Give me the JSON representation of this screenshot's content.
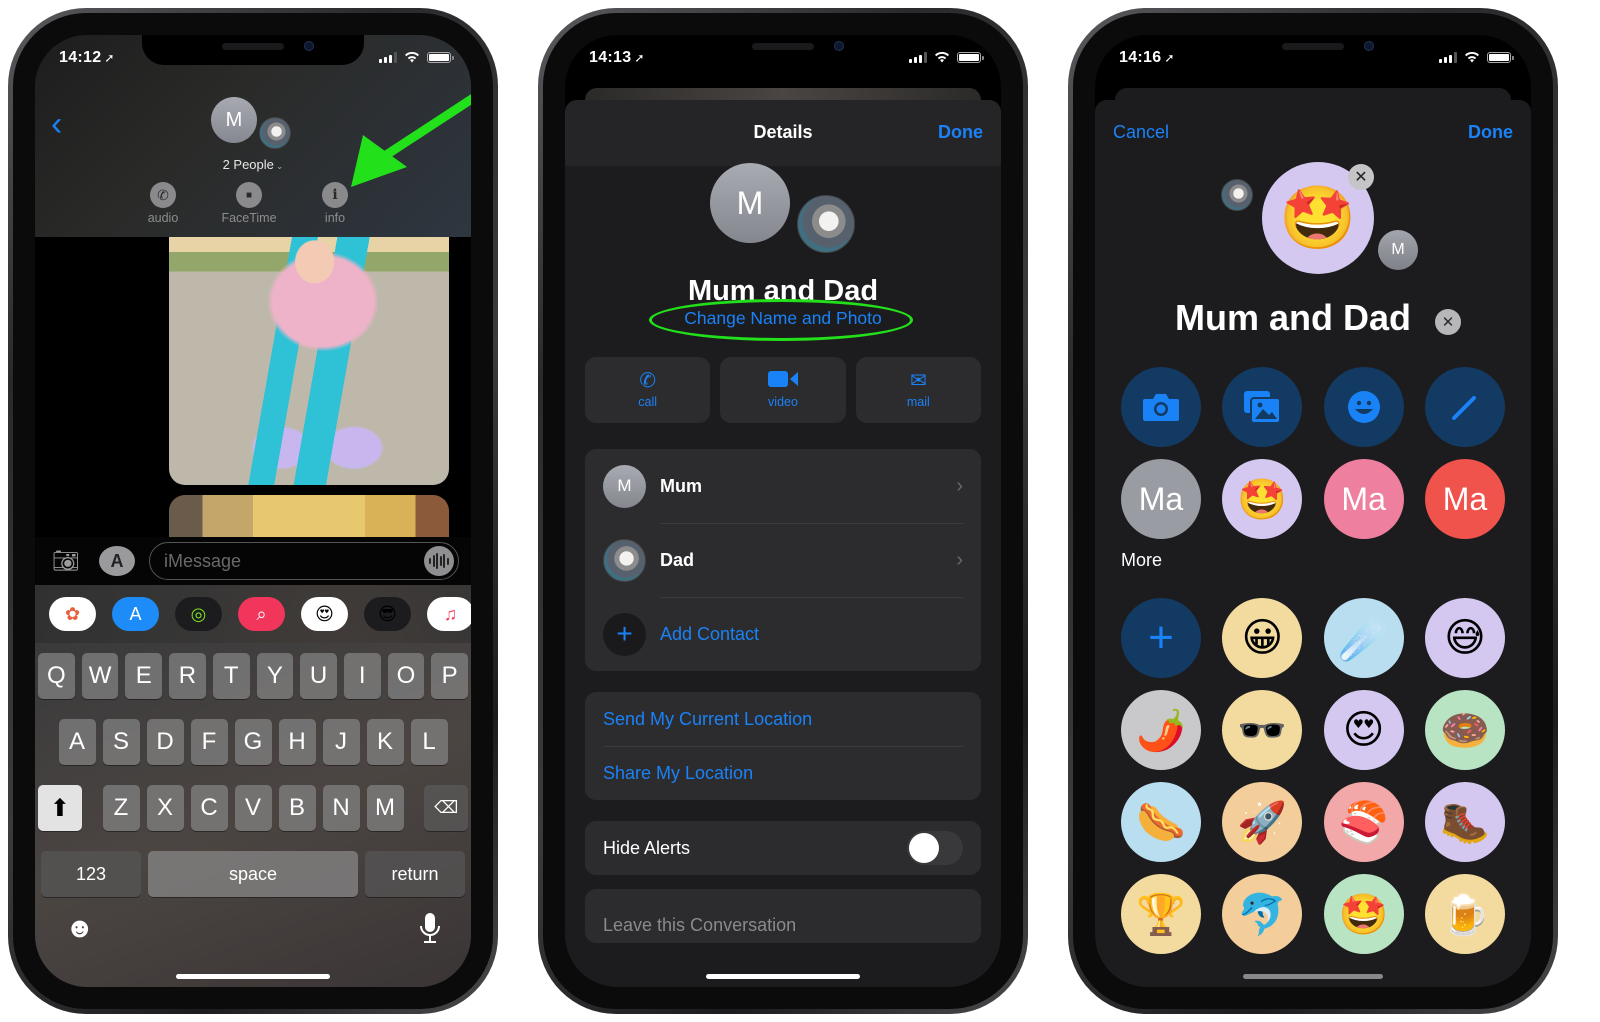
{
  "phone1": {
    "status": {
      "time": "14:12",
      "location_icon": "location-arrow-icon"
    },
    "header": {
      "back_icon": "chevron-left-icon",
      "avatar_initial": "M",
      "group_label": "2 People",
      "group_chevron": "⌄",
      "actions": [
        {
          "label": "audio",
          "icon": "phone-icon",
          "glyph": "✆"
        },
        {
          "label": "FaceTime",
          "icon": "video-camera-icon",
          "glyph": "■"
        },
        {
          "label": "info",
          "icon": "info-icon",
          "glyph": "i"
        }
      ]
    },
    "annotation": {
      "arrow_color": "#22e01a",
      "points_to": "info"
    },
    "compose": {
      "camera_icon": "camera-icon",
      "appstore_icon": "app-store-icon",
      "placeholder": "iMessage",
      "audio_icon": "waveform-icon"
    },
    "app_drawer": [
      {
        "name": "photos",
        "glyph": "✿",
        "bg": "#ffffff",
        "fg": "#e8603c"
      },
      {
        "name": "app-store",
        "glyph": "A",
        "bg": "#1d8cf8",
        "fg": "#ffffff"
      },
      {
        "name": "activity",
        "glyph": "◎",
        "bg": "#1c1c1e",
        "fg": "#7ae021"
      },
      {
        "name": "images-search",
        "glyph": "⌕",
        "bg": "#f2355b",
        "fg": "#ffffff"
      },
      {
        "name": "memoji-stickers",
        "glyph": "😍",
        "bg": "#ffffff",
        "fg": "#000"
      },
      {
        "name": "animoji",
        "glyph": "😎",
        "bg": "#1c1c1e",
        "fg": "#000"
      },
      {
        "name": "music",
        "glyph": "♫",
        "bg": "#ffffff",
        "fg": "#f94263"
      }
    ],
    "keyboard": {
      "row1": [
        "Q",
        "W",
        "E",
        "R",
        "T",
        "Y",
        "U",
        "I",
        "O",
        "P"
      ],
      "row2": [
        "A",
        "S",
        "D",
        "F",
        "G",
        "H",
        "J",
        "K",
        "L"
      ],
      "row3": [
        "Z",
        "X",
        "C",
        "V",
        "B",
        "N",
        "M"
      ],
      "shift_glyph": "⬆",
      "delete_glyph": "⌫",
      "numbers_label": "123",
      "space_label": "space",
      "return_label": "return",
      "emoji_glyph": "☻",
      "mic_glyph": "🎙"
    }
  },
  "phone2": {
    "status": {
      "time": "14:13"
    },
    "nav": {
      "title": "Details",
      "done": "Done"
    },
    "avatar_initial": "M",
    "group_name": "Mum and Dad",
    "change_link": "Change Name and Photo",
    "annotation": {
      "ellipse_color": "#22e01a",
      "highlights": "Change Name and Photo"
    },
    "actions": [
      {
        "label": "call",
        "icon": "phone-icon",
        "glyph": "✆"
      },
      {
        "label": "video",
        "icon": "video-camera-icon",
        "glyph": "▶"
      },
      {
        "label": "mail",
        "icon": "envelope-icon",
        "glyph": "✉"
      }
    ],
    "members": [
      {
        "name": "Mum",
        "initial": "M",
        "avatar": "initial"
      },
      {
        "name": "Dad",
        "avatar": "photo"
      }
    ],
    "add_contact": "Add Contact",
    "location": [
      "Send My Current Location",
      "Share My Location"
    ],
    "hide_alerts": {
      "label": "Hide Alerts",
      "on": false
    },
    "leave": "Leave this Conversation"
  },
  "phone3": {
    "status": {
      "time": "14:16"
    },
    "nav": {
      "cancel": "Cancel",
      "done": "Done"
    },
    "selected_emoji": "🤩",
    "small_avatar_initial": "M",
    "group_name": "Mum and Dad",
    "tools": [
      {
        "name": "camera",
        "glyph": "📷"
      },
      {
        "name": "photos",
        "glyph": "🖼"
      },
      {
        "name": "emoji",
        "glyph": "☻"
      },
      {
        "name": "pencil",
        "glyph": "✎"
      }
    ],
    "suggestions": [
      {
        "type": "mono",
        "text": "Ma",
        "bg": "#9a9ca4"
      },
      {
        "type": "emoji",
        "text": "🤩",
        "bg": "#d4c8f0"
      },
      {
        "type": "mono",
        "text": "Ma",
        "bg": "#ef7f9f"
      },
      {
        "type": "mono",
        "text": "Ma",
        "bg": "#f0524c"
      }
    ],
    "more_label": "More",
    "more_items": [
      {
        "text": "+",
        "bg": "#133a63",
        "type": "add"
      },
      {
        "text": "😀",
        "bg": "#f3dba0"
      },
      {
        "text": "☄️",
        "bg": "#b8def0"
      },
      {
        "text": "😅",
        "bg": "#d4c8f0"
      },
      {
        "text": "🌶️",
        "bg": "#c9c9cb"
      },
      {
        "text": "🕶️",
        "bg": "#f3dba0"
      },
      {
        "text": "😍",
        "bg": "#d4c8f0"
      },
      {
        "text": "🍩",
        "bg": "#b9e4c4"
      },
      {
        "text": "🌭",
        "bg": "#b8def0"
      },
      {
        "text": "🚀",
        "bg": "#f3cd9a"
      },
      {
        "text": "🍣",
        "bg": "#f2a8a8"
      },
      {
        "text": "🥾",
        "bg": "#d4c8f0"
      },
      {
        "text": "🏆",
        "bg": "#f3dba0"
      },
      {
        "text": "🐬",
        "bg": "#f3cd9a"
      },
      {
        "text": "🤩",
        "bg": "#b9e4c4"
      },
      {
        "text": "🍺",
        "bg": "#f3dba0"
      }
    ]
  }
}
